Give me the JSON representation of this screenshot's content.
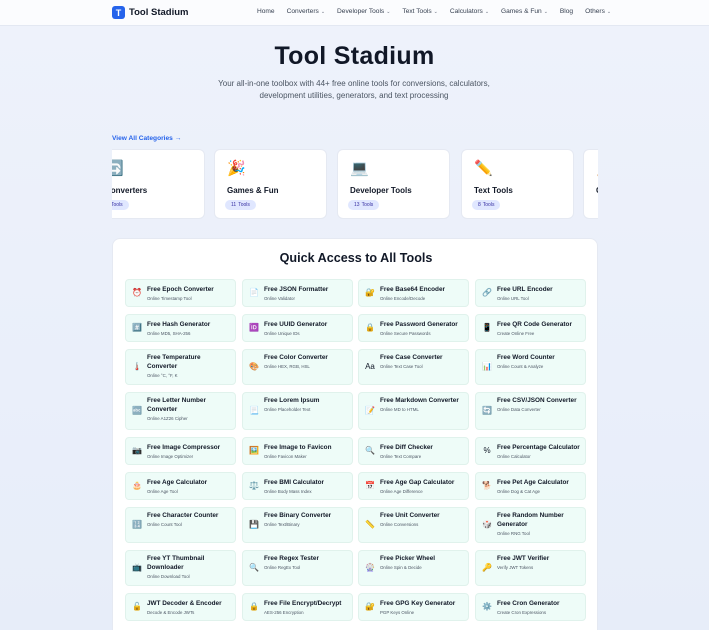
{
  "brand": {
    "logo_letter": "T",
    "name": "Tool Stadium"
  },
  "nav": {
    "items": [
      {
        "label": "Home",
        "dropdown": false
      },
      {
        "label": "Converters",
        "dropdown": true
      },
      {
        "label": "Developer Tools",
        "dropdown": true
      },
      {
        "label": "Text Tools",
        "dropdown": true
      },
      {
        "label": "Calculators",
        "dropdown": true
      },
      {
        "label": "Games & Fun",
        "dropdown": true
      },
      {
        "label": "Blog",
        "dropdown": false
      },
      {
        "label": "Others",
        "dropdown": true
      }
    ]
  },
  "hero": {
    "title": "Tool Stadium",
    "subtitle": "Your all-in-one toolbox with 44+ free online tools for conversions, calculators, development utilities, generators, and text processing"
  },
  "categories": {
    "view_all": "View All Categories",
    "arrow": "→",
    "items": [
      {
        "icon": "🔄",
        "title": "Converters",
        "count": "",
        "label": "Tools"
      },
      {
        "icon": "🎉",
        "title": "Games & Fun",
        "count": "11",
        "label": "Tools"
      },
      {
        "icon": "💻",
        "title": "Developer Tools",
        "count": "13",
        "label": "Tools"
      },
      {
        "icon": "✏️",
        "title": "Text Tools",
        "count": "8",
        "label": "Tools"
      },
      {
        "icon": "🧮",
        "title": "C",
        "count": "",
        "label": ""
      }
    ]
  },
  "quick": {
    "title": "Quick Access to All Tools",
    "tools": [
      {
        "icon": "⏰",
        "name": "Free Epoch Converter",
        "desc": "Online Timestamp Tool"
      },
      {
        "icon": "📄",
        "name": "Free JSON Formatter",
        "desc": "Online Validator"
      },
      {
        "icon": "🔐",
        "name": "Free Base64 Encoder",
        "desc": "Online Encode/Decode"
      },
      {
        "icon": "🔗",
        "name": "Free URL Encoder",
        "desc": "Online URL Tool"
      },
      {
        "icon": "#️⃣",
        "name": "Free Hash Generator",
        "desc": "Online MD5, SHA-256"
      },
      {
        "icon": "🆔",
        "name": "Free UUID Generator",
        "desc": "Online Unique IDs"
      },
      {
        "icon": "🔒",
        "name": "Free Password Generator",
        "desc": "Online Secure Passwords"
      },
      {
        "icon": "📱",
        "name": "Free QR Code Generator",
        "desc": "Create Online Free"
      },
      {
        "icon": "🌡️",
        "name": "Free Temperature Converter",
        "desc": "Online °C, °F, K"
      },
      {
        "icon": "🎨",
        "name": "Free Color Converter",
        "desc": "Online HEX, RGB, HSL"
      },
      {
        "icon": "Aa",
        "name": "Free Case Converter",
        "desc": "Online Text Case Tool"
      },
      {
        "icon": "📊",
        "name": "Free Word Counter",
        "desc": "Online Count & Analyze"
      },
      {
        "icon": "🔤",
        "name": "Free Letter Number Converter",
        "desc": "Online A1Z26 Cipher"
      },
      {
        "icon": "📃",
        "name": "Free Lorem Ipsum",
        "desc": "Online Placeholder Text"
      },
      {
        "icon": "📝",
        "name": "Free Markdown Converter",
        "desc": "Online MD to HTML"
      },
      {
        "icon": "🔄",
        "name": "Free CSV/JSON Converter",
        "desc": "Online Data Converter"
      },
      {
        "icon": "📷",
        "name": "Free Image Compressor",
        "desc": "Online Image Optimizer"
      },
      {
        "icon": "🖼️",
        "name": "Free Image to Favicon",
        "desc": "Online Favicon Maker"
      },
      {
        "icon": "🔍",
        "name": "Free Diff Checker",
        "desc": "Online Text Compare"
      },
      {
        "icon": "%",
        "name": "Free Percentage Calculator",
        "desc": "Online Calculator"
      },
      {
        "icon": "🎂",
        "name": "Free Age Calculator",
        "desc": "Online Age Tool"
      },
      {
        "icon": "⚖️",
        "name": "Free BMI Calculator",
        "desc": "Online Body Mass Index"
      },
      {
        "icon": "📅",
        "name": "Free Age Gap Calculator",
        "desc": "Online Age Difference"
      },
      {
        "icon": "🐕",
        "name": "Free Pet Age Calculator",
        "desc": "Online Dog & Cat Age"
      },
      {
        "icon": "🔢",
        "name": "Free Character Counter",
        "desc": "Online Count Tool"
      },
      {
        "icon": "💾",
        "name": "Free Binary Converter",
        "desc": "Online Text/Binary"
      },
      {
        "icon": "📏",
        "name": "Free Unit Converter",
        "desc": "Online Conversions"
      },
      {
        "icon": "🎲",
        "name": "Free Random Number Generator",
        "desc": "Online RNG Tool"
      },
      {
        "icon": "📺",
        "name": "Free YT Thumbnail Downloader",
        "desc": "Online Download Tool"
      },
      {
        "icon": "🔍",
        "name": "Free Regex Tester",
        "desc": "Online RegEx Tool"
      },
      {
        "icon": "🎡",
        "name": "Free Picker Wheel",
        "desc": "Online Spin & Decide"
      },
      {
        "icon": "🔑",
        "name": "Free JWT Verifier",
        "desc": "Verify JWT Tokens"
      },
      {
        "icon": "🔓",
        "name": "JWT Decoder & Encoder",
        "desc": "Decode & Encode JWTs"
      },
      {
        "icon": "🔒",
        "name": "Free File Encrypt/Decrypt",
        "desc": "AES-256 Encryption"
      },
      {
        "icon": "🔐",
        "name": "Free GPG Key Generator",
        "desc": "PGP Keys Online"
      },
      {
        "icon": "⚙️",
        "name": "Free Cron Generator",
        "desc": "Create Cron Expressions"
      }
    ]
  }
}
